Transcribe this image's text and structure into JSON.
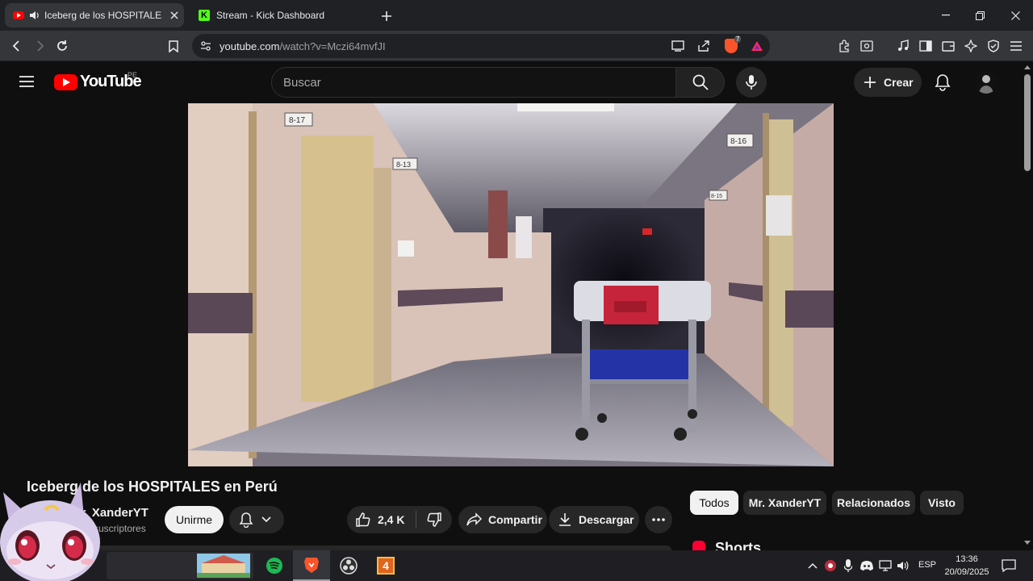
{
  "browser": {
    "tabs": [
      {
        "title": "Iceberg de los HOSPITALES en Perú",
        "active": true
      },
      {
        "title": "Stream - Kick Dashboard",
        "active": false
      }
    ],
    "url_host": "youtube.com",
    "url_path": "/watch?v=Mczi64mvfJI",
    "brave_shield_count": "7"
  },
  "youtube": {
    "logo_text": "YouTube",
    "region": "PE",
    "search_placeholder": "Buscar",
    "create_label": "Crear",
    "video": {
      "title": "Iceberg de los HOSPITALES en Perú",
      "channel": "Mr. XanderYT",
      "subscribers": "suscriptores",
      "join_label": "Unirme",
      "likes": "2,4 K",
      "share_label": "Compartir",
      "download_label": "Descargar",
      "sign_labels": [
        "8-17",
        "8-13",
        "8-16",
        "8-15"
      ]
    },
    "chips": [
      "Todos",
      "Mr. XanderYT",
      "Relacionados",
      "Visto"
    ],
    "shorts_label": "Shorts"
  },
  "taskbar": {
    "language": "ESP",
    "time": "13:36",
    "date": "20/09/2025",
    "badge": "4"
  },
  "colors": {
    "youtube_red": "#ff0000",
    "kick_green": "#53fc18",
    "spotify_green": "#1db954",
    "brave_orange": "#fb542b"
  }
}
